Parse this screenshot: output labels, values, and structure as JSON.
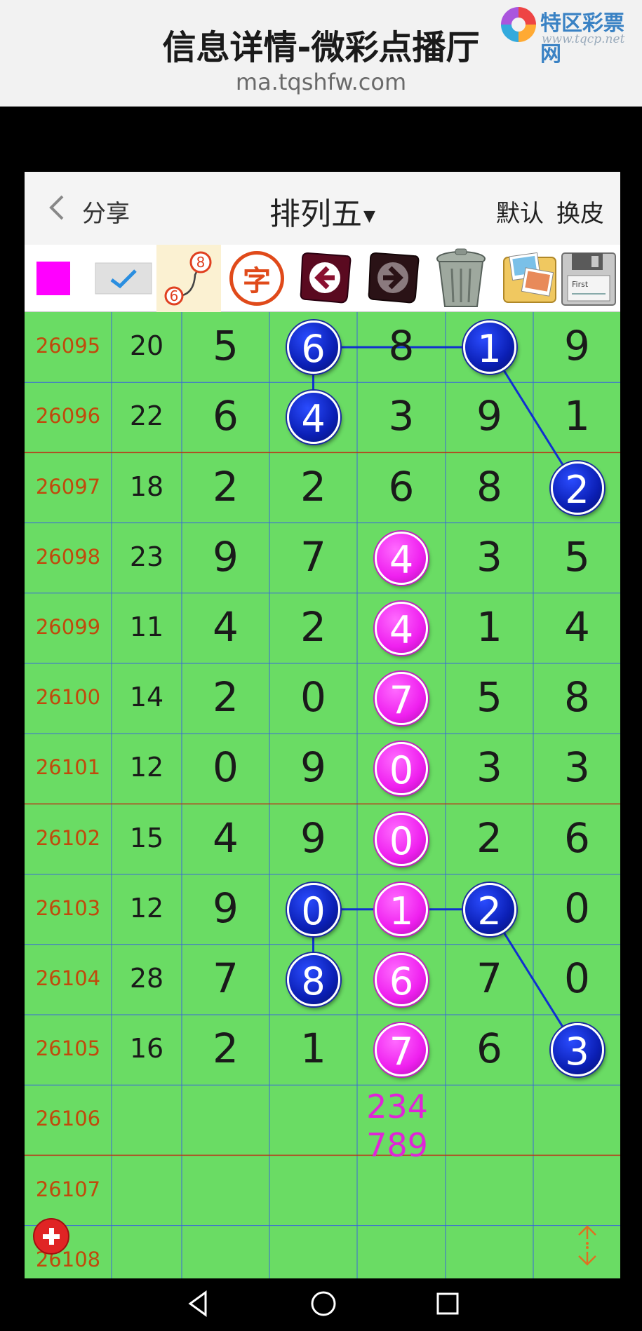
{
  "browser": {
    "title": "信息详情-微彩点播厅",
    "url": "ma.tqshfw.com",
    "watermark": {
      "name": "特区彩票网",
      "url": "www.tqcp.net"
    }
  },
  "header": {
    "share_label": "分享",
    "game_label": "排列五",
    "default_label": "默认",
    "skin_label": "换皮"
  },
  "toolbar": {
    "items": [
      {
        "name": "color-swatch",
        "color": "#ff00ff"
      },
      {
        "name": "check-icon"
      },
      {
        "name": "line-connect-icon",
        "labels": [
          "6",
          "8"
        ]
      },
      {
        "name": "font-icon",
        "text": "字"
      },
      {
        "name": "undo-icon"
      },
      {
        "name": "redo-icon"
      },
      {
        "name": "trash-icon"
      },
      {
        "name": "images-icon"
      },
      {
        "name": "floppy-save-icon",
        "text": "First"
      }
    ]
  },
  "colors": {
    "grid_bg": "#6adc64",
    "issue_text": "#c04a0c",
    "blue_ball": "#0b1fb5",
    "pink_ball": "#ef20ef",
    "prediction": "#e024d8"
  },
  "grid": {
    "rows": [
      {
        "issue": "26095",
        "sum": "20",
        "digits": [
          "5",
          "6",
          "8",
          "1",
          "9"
        ],
        "marks": [
          "",
          "blue",
          "",
          "blue",
          ""
        ]
      },
      {
        "issue": "26096",
        "sum": "22",
        "digits": [
          "6",
          "4",
          "3",
          "9",
          "1"
        ],
        "marks": [
          "",
          "blue",
          "",
          "",
          ""
        ]
      },
      {
        "issue": "26097",
        "sum": "18",
        "digits": [
          "2",
          "2",
          "6",
          "8",
          "2"
        ],
        "marks": [
          "",
          "",
          "",
          "",
          "blue"
        ]
      },
      {
        "issue": "26098",
        "sum": "23",
        "digits": [
          "9",
          "7",
          "4",
          "3",
          "5"
        ],
        "marks": [
          "",
          "",
          "pink",
          "",
          ""
        ]
      },
      {
        "issue": "26099",
        "sum": "11",
        "digits": [
          "4",
          "2",
          "4",
          "1",
          "4"
        ],
        "marks": [
          "",
          "",
          "pink",
          "",
          ""
        ]
      },
      {
        "issue": "26100",
        "sum": "14",
        "digits": [
          "2",
          "0",
          "7",
          "5",
          "8"
        ],
        "marks": [
          "",
          "",
          "pink",
          "",
          ""
        ]
      },
      {
        "issue": "26101",
        "sum": "12",
        "digits": [
          "0",
          "9",
          "0",
          "3",
          "3"
        ],
        "marks": [
          "",
          "",
          "pink",
          "",
          ""
        ]
      },
      {
        "issue": "26102",
        "sum": "15",
        "digits": [
          "4",
          "9",
          "0",
          "2",
          "6"
        ],
        "marks": [
          "",
          "",
          "pink",
          "",
          ""
        ]
      },
      {
        "issue": "26103",
        "sum": "12",
        "digits": [
          "9",
          "0",
          "1",
          "2",
          "0"
        ],
        "marks": [
          "",
          "blue",
          "pink",
          "blue",
          ""
        ]
      },
      {
        "issue": "26104",
        "sum": "28",
        "digits": [
          "7",
          "8",
          "6",
          "7",
          "0"
        ],
        "marks": [
          "",
          "blue",
          "pink",
          "",
          ""
        ]
      },
      {
        "issue": "26105",
        "sum": "16",
        "digits": [
          "2",
          "1",
          "7",
          "6",
          "3"
        ],
        "marks": [
          "",
          "",
          "pink",
          "",
          "blue"
        ]
      },
      {
        "issue": "26106",
        "sum": "",
        "digits": [
          "",
          "",
          "",
          "",
          ""
        ],
        "marks": [
          "",
          "",
          "",
          "",
          ""
        ]
      },
      {
        "issue": "26107",
        "sum": "",
        "digits": [
          "",
          "",
          "",
          "",
          ""
        ],
        "marks": [
          "",
          "",
          "",
          "",
          ""
        ]
      },
      {
        "issue": "26108",
        "sum": "",
        "digits": [
          "",
          "",
          "",
          "",
          ""
        ],
        "marks": [
          "",
          "",
          "",
          "",
          ""
        ]
      }
    ],
    "prediction": {
      "issue": "26106",
      "column": 3,
      "lines": [
        "234",
        "789"
      ]
    },
    "connectors": [
      {
        "from": [
          0,
          1
        ],
        "to": [
          0,
          3
        ]
      },
      {
        "from": [
          0,
          1
        ],
        "to": [
          1,
          1
        ]
      },
      {
        "from": [
          0,
          3
        ],
        "to": [
          2,
          4
        ]
      },
      {
        "from": [
          8,
          1
        ],
        "to": [
          8,
          3
        ]
      },
      {
        "from": [
          8,
          1
        ],
        "to": [
          9,
          1
        ]
      },
      {
        "from": [
          8,
          3
        ],
        "to": [
          10,
          4
        ]
      }
    ]
  },
  "nav": {
    "items": [
      "back-nav-icon",
      "home-nav-icon",
      "recents-nav-icon"
    ]
  }
}
